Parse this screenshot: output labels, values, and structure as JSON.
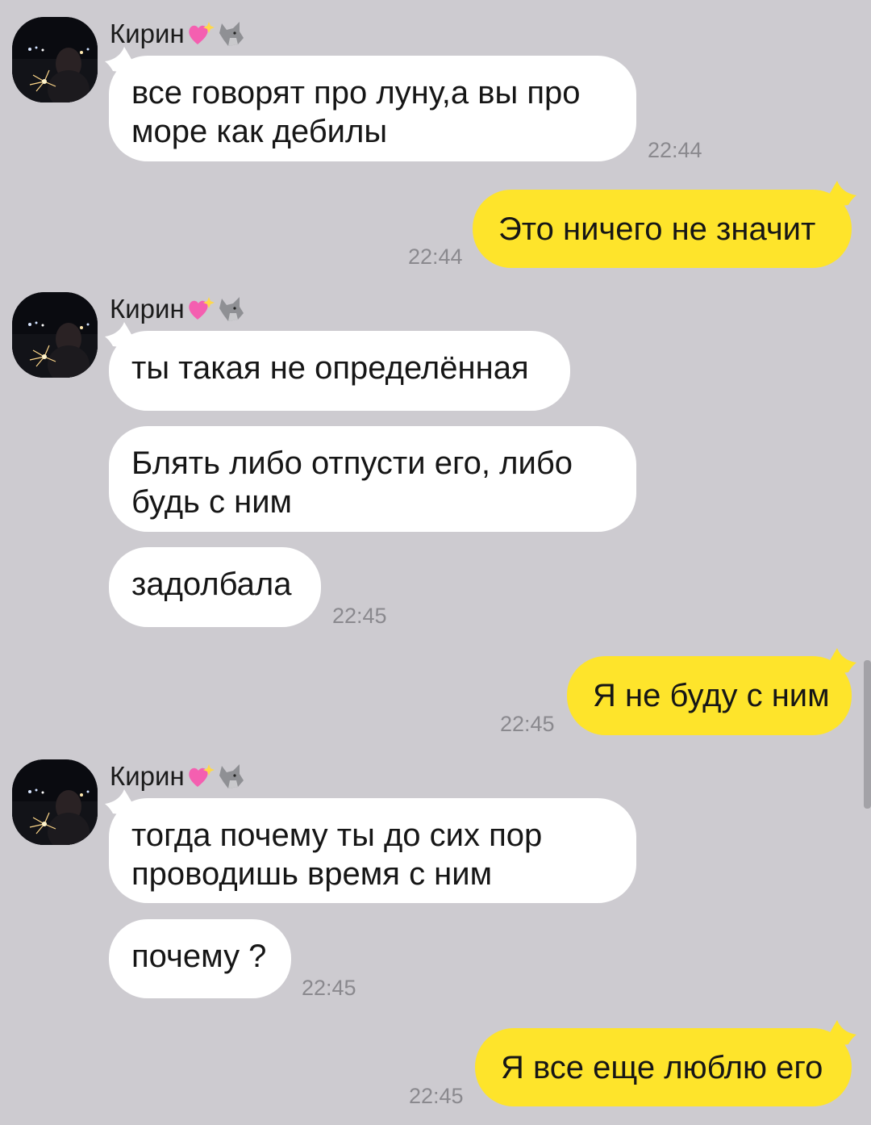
{
  "contact": {
    "name": "Кирин",
    "heart_icon": "sparkling-heart-icon",
    "wolf_icon": "wolf-icon",
    "avatar": "night-photo-with-sparkler"
  },
  "colors": {
    "background": "#cdcbd0",
    "incoming_bubble": "#ffffff",
    "outgoing_bubble": "#fee42b",
    "timestamp": "#8a898e"
  },
  "messages": [
    {
      "dir": "in",
      "lines": [
        "все говорят про луну,а вы про",
        "море как дебилы"
      ],
      "time": "22:44"
    },
    {
      "dir": "out",
      "lines": [
        "Это ничего не значит"
      ],
      "time": "22:44"
    },
    {
      "dir": "in",
      "lines": [
        "ты такая не определённая"
      ],
      "time": ""
    },
    {
      "dir": "in",
      "lines": [
        "Блять либо отпусти его, либо",
        "будь с ним"
      ],
      "time": ""
    },
    {
      "dir": "in",
      "lines": [
        "задолбала"
      ],
      "time": "22:45"
    },
    {
      "dir": "out",
      "lines": [
        "Я не буду с ним"
      ],
      "time": "22:45"
    },
    {
      "dir": "in",
      "lines": [
        "тогда почему ты до сих пор",
        "проводишь время с ним"
      ],
      "time": ""
    },
    {
      "dir": "in",
      "lines": [
        "почему ?"
      ],
      "time": "22:45"
    },
    {
      "dir": "out",
      "lines": [
        "Я все еще люблю его"
      ],
      "time": "22:45"
    }
  ]
}
